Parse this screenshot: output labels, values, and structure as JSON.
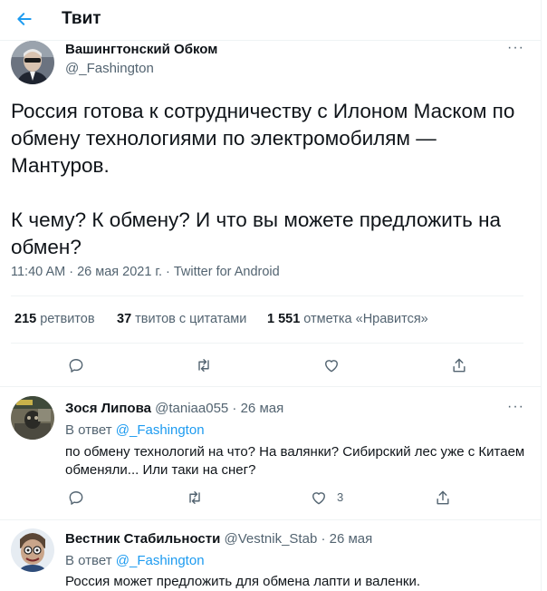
{
  "header": {
    "title": "Твит",
    "back_icon": "arrow-left-icon"
  },
  "colors": {
    "accent": "#1d9bf0",
    "secondary_text": "#536471"
  },
  "tweet": {
    "author_name": "Вашингтонский Обком",
    "author_handle": "@_Fashington",
    "text": "Россия готова к сотрудничеству с Илоном Маском по обмену технологиями по электромобилям — Мантуров.\n\nК чему? К обмену? И что вы можете предложить на обмен?",
    "meta": "11:40 AM · 26 мая 2021 г. · Twitter for Android",
    "stats": {
      "retweets_count": "215",
      "retweets_label": "ретвитов",
      "quotes_count": "37",
      "quotes_label": "твитов с цитатами",
      "likes_count": "1 551",
      "likes_label": "отметка «Нравится»"
    },
    "actions": [
      "reply-icon",
      "retweet-icon",
      "like-icon",
      "share-icon"
    ]
  },
  "replies": [
    {
      "name": "Зося Липова",
      "handle_time": "@taniaa055 · 26 мая",
      "reply_to_prefix": "В ответ",
      "reply_to_handle": "@_Fashington",
      "text": "по обмену технологий на что? На валянки? Сибирский лес уже с Китаем\nобменяли...  Или таки на снег?",
      "like_count": "3"
    },
    {
      "name": "Вестник Стабильности",
      "handle_time": "@Vestnik_Stab · 26 мая",
      "reply_to_prefix": "В ответ",
      "reply_to_handle": "@_Fashington",
      "text": "Россия может предложить для обмена лапти и валенки."
    }
  ]
}
